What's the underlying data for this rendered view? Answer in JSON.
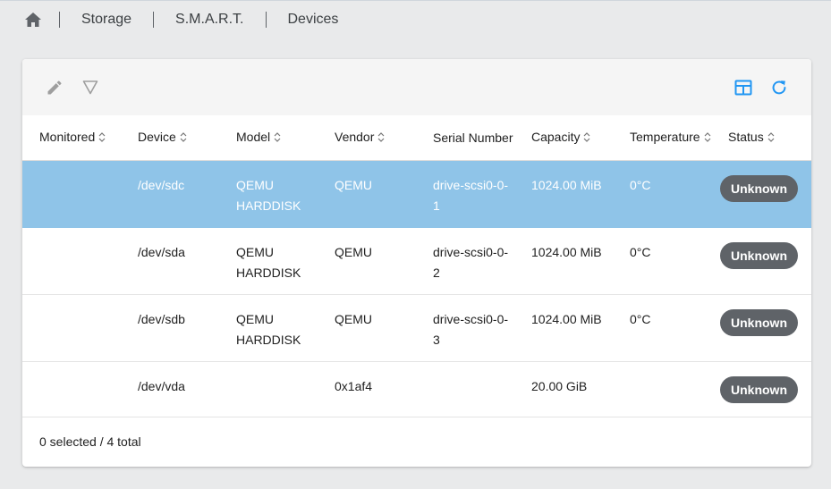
{
  "breadcrumb": {
    "home_icon": "home-icon",
    "items": [
      "Storage",
      "S.M.A.R.T.",
      "Devices"
    ]
  },
  "toolbar": {
    "icons": {
      "edit": "pencil-icon",
      "filter": "filter-icon",
      "columns": "table-columns-icon",
      "refresh": "refresh-icon"
    },
    "accent_color": "#2196f3"
  },
  "table": {
    "columns": [
      "Monitored",
      "Device",
      "Model",
      "Vendor",
      "Serial Number",
      "Capacity",
      "Temperature",
      "Status"
    ],
    "rows": [
      {
        "monitored": "",
        "device": "/dev/sdc",
        "model": "QEMU HARDDISK",
        "vendor": "QEMU",
        "serial": "drive-scsi0-0-1",
        "capacity": "1024.00 MiB",
        "temperature": "0°C",
        "status": "Unknown",
        "selected": true
      },
      {
        "monitored": "",
        "device": "/dev/sda",
        "model": "QEMU HARDDISK",
        "vendor": "QEMU",
        "serial": "drive-scsi0-0-2",
        "capacity": "1024.00 MiB",
        "temperature": "0°C",
        "status": "Unknown",
        "selected": false
      },
      {
        "monitored": "",
        "device": "/dev/sdb",
        "model": "QEMU HARDDISK",
        "vendor": "QEMU",
        "serial": "drive-scsi0-0-3",
        "capacity": "1024.00 MiB",
        "temperature": "0°C",
        "status": "Unknown",
        "selected": false
      },
      {
        "monitored": "",
        "device": "/dev/vda",
        "model": "",
        "vendor": "0x1af4",
        "serial": "",
        "capacity": "20.00 GiB",
        "temperature": "",
        "status": "Unknown",
        "selected": false
      }
    ],
    "selected_row_color": "#8fc4e8",
    "status_badge_color": "#5f6368"
  },
  "footer": {
    "summary": "0 selected / 4 total"
  }
}
